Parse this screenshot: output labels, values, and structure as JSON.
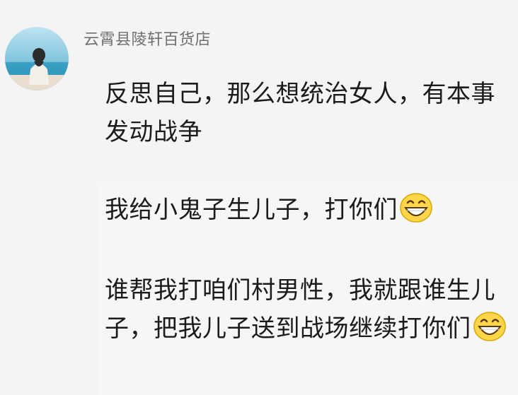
{
  "comment": {
    "username": "云霄县陵轩百货店",
    "paragraphs": {
      "p1": "反思自己，那么想统治女人，有本事发动战争",
      "p2": "我给小鬼子生儿子，打你们",
      "p3": "谁帮我打咱们村男性，我就跟谁生儿子，把我儿子送到战场继续打你们"
    },
    "avatar_icon": "woman-at-beach-avatar",
    "emoji_icon": "grinning-face-emoji"
  }
}
